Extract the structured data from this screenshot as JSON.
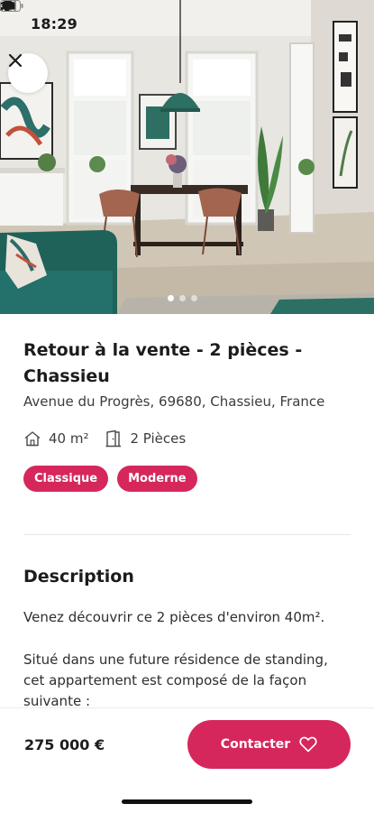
{
  "status_bar": {
    "time": "18:29",
    "icons": [
      "location-arrow-icon",
      "signal-icon",
      "wifi-icon",
      "battery-icon"
    ]
  },
  "gallery": {
    "image": "apartment-interior-photo",
    "page_count": 3,
    "active_index": 0
  },
  "listing": {
    "title": "Retour à la vente - 2 pièces - Chassieu",
    "address": "Avenue du Progrès, 69680, Chassieu, France",
    "surface": "40 m²",
    "rooms": "2 Pièces",
    "tags": [
      "Classique",
      "Moderne"
    ]
  },
  "description": {
    "heading": "Description",
    "paragraphs": [
      "Venez découvrir ce 2 pièces d'environ 40m².",
      "Situé dans une future résidence de standing, cet appartement est composé de la façon suivante :"
    ]
  },
  "footer": {
    "price": "275 000 €",
    "contact_label": "Contacter"
  },
  "colors": {
    "accent": "#d6275c",
    "text": "#1c1c1c"
  }
}
